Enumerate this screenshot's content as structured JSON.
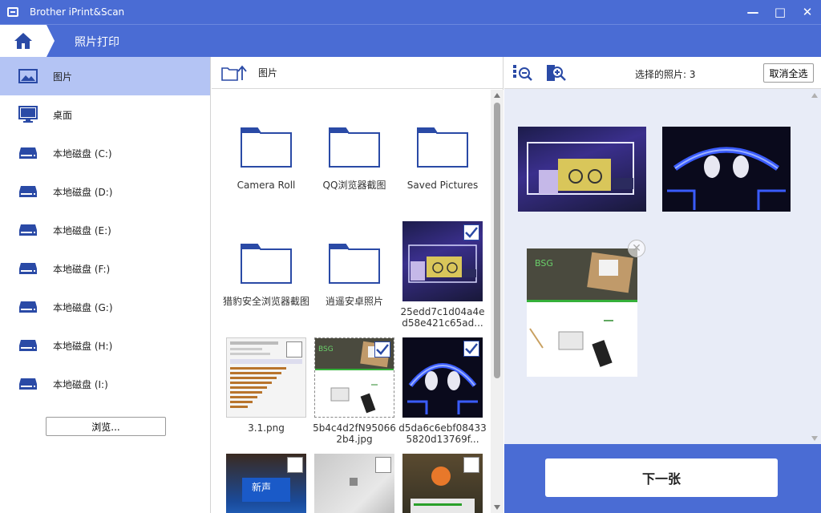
{
  "window": {
    "title": "Brother iPrint&Scan",
    "minimize": "—",
    "maximize": "□",
    "close": "✕"
  },
  "header": {
    "breadcrumb": "照片打印"
  },
  "sidebar": {
    "items": [
      {
        "label": "图片",
        "icon": "picture-icon",
        "active": true
      },
      {
        "label": "桌面",
        "icon": "desktop-icon"
      },
      {
        "label": "本地磁盘 (C:)",
        "icon": "drive-icon"
      },
      {
        "label": "本地磁盘 (D:)",
        "icon": "drive-icon"
      },
      {
        "label": "本地磁盘 (E:)",
        "icon": "drive-icon"
      },
      {
        "label": "本地磁盘 (F:)",
        "icon": "drive-icon"
      },
      {
        "label": "本地磁盘 (G:)",
        "icon": "drive-icon"
      },
      {
        "label": "本地磁盘 (H:)",
        "icon": "drive-icon"
      },
      {
        "label": "本地磁盘 (I:)",
        "icon": "drive-icon"
      }
    ],
    "browse_label": "浏览..."
  },
  "browser": {
    "path": "图片",
    "tiles": [
      {
        "name": "Camera Roll",
        "kind": "folder"
      },
      {
        "name": "QQ浏览器截图",
        "kind": "folder"
      },
      {
        "name": "Saved Pictures",
        "kind": "folder"
      },
      {
        "name": "猎豹安全浏览器截图",
        "kind": "folder"
      },
      {
        "name": "逍遥安卓照片",
        "kind": "folder"
      },
      {
        "name": "25edd7c1d04a4ed58e421c65ad...",
        "kind": "image",
        "checked": true
      },
      {
        "name": "3.1.png",
        "kind": "image",
        "checked": false
      },
      {
        "name": "5b4c4d2fN950662b4.jpg",
        "kind": "image",
        "checked": true
      },
      {
        "name": "d5da6c6ebf084335820d13769f...",
        "kind": "image",
        "checked": true
      },
      {
        "name": "",
        "kind": "image",
        "checked": false
      },
      {
        "name": "",
        "kind": "image",
        "checked": false
      },
      {
        "name": "",
        "kind": "image",
        "checked": false
      }
    ]
  },
  "preview": {
    "selected_label": "选择的照片: 3",
    "deselect_all": "取消全选",
    "next_label": "下一张"
  },
  "colors": {
    "brand": "#4a6cd4",
    "sidebar_active": "#b4c4f4",
    "folder_blue": "#2a4aa6"
  }
}
